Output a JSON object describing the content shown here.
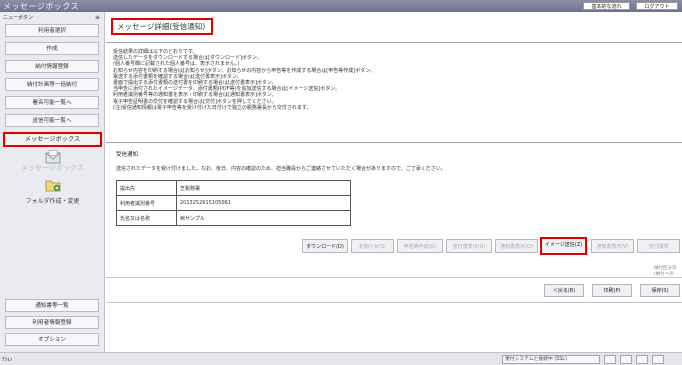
{
  "app": {
    "title": "メッセージボックス"
  },
  "header": {
    "btn_basic": "基本的な流れ",
    "btn_logout": "ログアウト"
  },
  "sidebar": {
    "menu_label": "ニューボタン",
    "collapse_icon": "≡",
    "items": [
      {
        "label": "利用者選択"
      },
      {
        "label": "作成"
      },
      {
        "label": "納付情報登録"
      },
      {
        "label": "納付計画等一括納付"
      },
      {
        "label": "署名可能一覧へ"
      },
      {
        "label": "送信可能一覧へ"
      },
      {
        "label": "メッセージボックス"
      }
    ],
    "msgbox_label": "メッセージボックス",
    "folder_label": "フォルダ作成・変更",
    "bottom_items": [
      {
        "label": "通知書等一覧"
      },
      {
        "label": "利用者情報登録"
      },
      {
        "label": "オプション"
      }
    ]
  },
  "main": {
    "page_title": "メッセージ詳細(受信通知)",
    "instructions": [
      "受信結果の詳細は以下のとおりです。",
      "送信したデータをダウンロードする場合は[ダウンロード]ボタン。",
      "(個人番号欄に記載された個人番号は、表示されません。)",
      "お知らせ内容を印刷する場合は[お知らせ]ボタン、お知らせの内容から申告等を作成する場合は[申告等作成]ボタン。",
      "電送する添付書類を確認する場合は[送付書表示]ボタン。",
      "書面で提出する添付書類の送付書を印刷する場合は[送付書表示]ボタン。",
      "当申告に添付されたイメージデータ、添付書類(PDF等)を追加送信する場合は[イメージ送信]ボタン。",
      "利用者識別番号等の通知書を表示・印刷する場合は[通知書表示]ボタン。",
      "電子申告証明書の交付を確認する場合は[交付]ボタンを押してください。",
      "(注)受信通知情報は電子申告等を受け付けた日付けで独立の税務署長から交付されます。"
    ],
    "notice_title": "受信通知",
    "notice_text": "送信されたデータを受け付けました。なお、後日、内容の確認のため、担当職員からご連絡させていただく場合がありますので、ご了承ください。",
    "info_rows": [
      {
        "key": "提出先",
        "value": "芝税務署"
      },
      {
        "key": "利用者識別番号",
        "value": "2013252615105061"
      },
      {
        "key": "氏名又は名称",
        "value": "㈱サンプル"
      }
    ],
    "action_buttons": {
      "download": "ダウンロード(D)",
      "oshirase": "お知らせ(S)",
      "shinkoku": "申告等作成(G)",
      "soufusho": "送付書表示(U)",
      "tsuchisho": "通知書表示(O)",
      "image": "イメージ送信(Z)",
      "tsuchi2": "通知書表示(V)",
      "kofu": "交付請求"
    },
    "mini_note": "納付区分等\n(納付への",
    "nav": {
      "back": "＜戻る(B)",
      "print": "印刷(P)",
      "save": "保存(S)"
    }
  },
  "status": {
    "left_text": "ｱｼｮﾝ",
    "center_text": "受付システムと接続中 (SSL)"
  },
  "colors": {
    "highlight": "#e10000",
    "topbar": "#7c7e98",
    "sidebar_bg": "#e9ebf1"
  }
}
